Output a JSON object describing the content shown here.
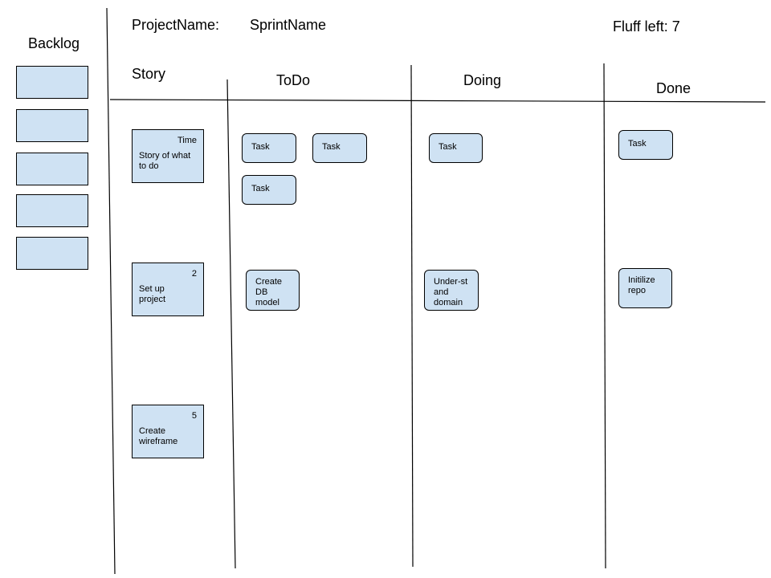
{
  "header": {
    "project_label": "ProjectName:",
    "sprint_label": "SprintName",
    "fluff_label": "Fluff left: 7"
  },
  "backlog": {
    "title": "Backlog",
    "slots": 5
  },
  "columns": {
    "story": "Story",
    "todo": "ToDo",
    "doing": "Doing",
    "done": "Done"
  },
  "stories": [
    {
      "estimate": "Time",
      "title": "Story of what to do",
      "todo": [
        "Task",
        "Task",
        "Task"
      ],
      "doing": [
        "Task"
      ],
      "done": [
        "Task"
      ]
    },
    {
      "estimate": "2",
      "title": "Set up project",
      "todo": [
        "Create DB model"
      ],
      "doing": [
        "Under-st and domain"
      ],
      "done": [
        "Initilize repo"
      ]
    },
    {
      "estimate": "5",
      "title": "Create wireframe",
      "todo": [],
      "doing": [],
      "done": []
    }
  ],
  "colors": {
    "card_fill": "#cfe2f3",
    "border": "#000000"
  }
}
